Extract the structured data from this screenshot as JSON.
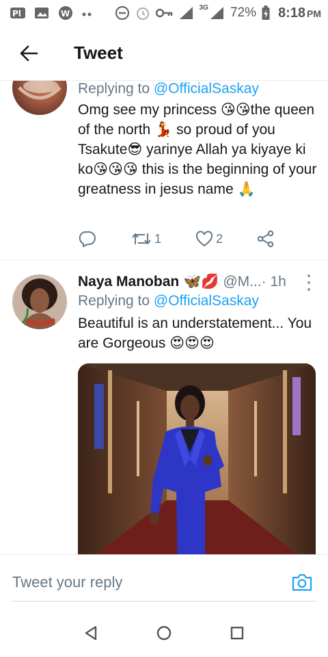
{
  "status_bar": {
    "battery": "72%",
    "time": "8:18",
    "ampm": "PM",
    "network": "3G",
    "icons": [
      "pill-icon",
      "image-icon",
      "ig-icon",
      "dots-icon",
      "dnd-icon",
      "alarm-icon",
      "key-icon",
      "signal-icon",
      "signal-icon",
      "battery-icon"
    ]
  },
  "header": {
    "title": "Tweet",
    "back_icon": "arrow-left-icon"
  },
  "tweets": [
    {
      "reply_prefix": "Replying to ",
      "reply_handle": "@OfficialSaskay",
      "text": "Omg see my princess 😘😘the queen of the north 💃 so proud of you Tsakute😎 yarinye Allah ya kiyaye ki ko😘😘😘 this is the beginning of your greatness in jesus name 🙏",
      "retweets": "1",
      "likes": "2"
    },
    {
      "name": "Naya Manoban 🦋💋",
      "handle": "@M...",
      "time": " · 1h",
      "reply_prefix": "Replying to ",
      "reply_handle": "@OfficialSaskay",
      "text": "Beautiful is an understatement... You are Gorgeous 😍😍😍"
    }
  ],
  "reply_bar": {
    "placeholder": "Tweet your reply",
    "camera_icon": "camera-icon"
  },
  "nav": {
    "icons": [
      "back-triangle-icon",
      "home-circle-icon",
      "recents-square-icon"
    ]
  },
  "colors": {
    "link": "#1da1f2",
    "secondary_text": "#657786",
    "divider": "#e6ecf0"
  }
}
